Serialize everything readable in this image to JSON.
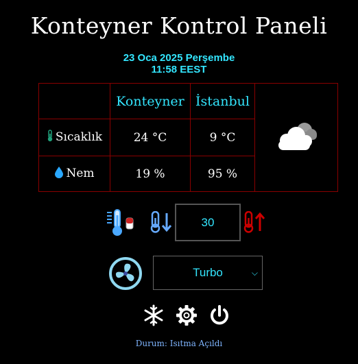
{
  "header": {
    "title": "Konteyner Kontrol Paneli",
    "date": "23 Oca 2025 Perşembe",
    "time": "11:58 EEST"
  },
  "table": {
    "columns": [
      "Konteyner",
      "İstanbul"
    ],
    "rows": [
      {
        "label": "Sıcaklık",
        "icon": "thermometer-icon",
        "konteyner": "24 °C",
        "istanbul": "9 °C"
      },
      {
        "label": "Nem",
        "icon": "water-drop-icon",
        "konteyner": "19 %",
        "istanbul": "95 %"
      }
    ],
    "weather_icon": "cloudy-icon"
  },
  "controls": {
    "setpoint": "30",
    "mode": "Turbo",
    "mode_options": [
      "Turbo"
    ]
  },
  "status": {
    "text": "Durum: Isıtma Açıldı"
  },
  "colors": {
    "accent": "#33e6ff",
    "border": "#8b0000",
    "status": "#7fb5ff",
    "heat": "#cc0000",
    "cool": "#66aaff"
  }
}
